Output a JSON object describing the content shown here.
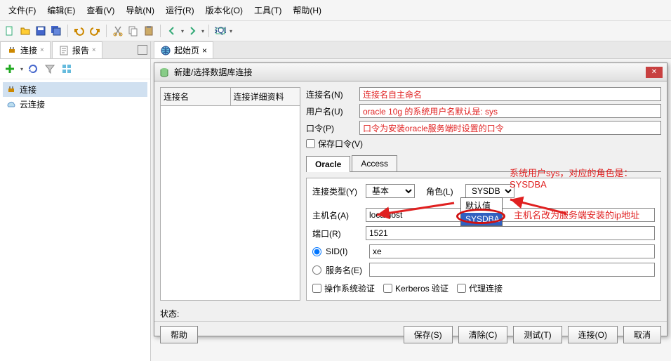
{
  "menu": [
    "文件(F)",
    "编辑(E)",
    "查看(V)",
    "导航(N)",
    "运行(R)",
    "版本化(O)",
    "工具(T)",
    "帮助(H)"
  ],
  "side_tabs": {
    "connections": "连接",
    "reports": "报告"
  },
  "tree": {
    "connections": "连接",
    "cloud": "云连接"
  },
  "content_tab": "起始页",
  "dialog": {
    "title": "新建/选择数据库连接",
    "left_cols": {
      "name": "连接名",
      "details": "连接详细资料"
    },
    "labels": {
      "conn_name": "连接名(N)",
      "username": "用户名(U)",
      "password": "口令(P)",
      "save_password": "保存口令(V)",
      "conn_type": "连接类型(Y)",
      "role": "角色(L)",
      "hostname": "主机名(A)",
      "port": "端口(R)",
      "sid": "SID(I)",
      "service": "服务名(E)",
      "os_auth": "操作系统验证",
      "kerberos": "Kerberos 验证",
      "proxy": "代理连接",
      "status": "状态:"
    },
    "tabs": {
      "oracle": "Oracle",
      "access": "Access"
    },
    "values": {
      "conn_type": "基本",
      "role": "SYSDBA",
      "role_options": [
        "默认值",
        "SYSDBA"
      ],
      "hostname": "localhost",
      "port": "1521",
      "sid": "xe"
    },
    "annotations": {
      "conn_name": "连接名自主命名",
      "username": "oracle 10g 的系统用户名默认是: sys",
      "password": "口令为安装oracle服务端时设置的口令",
      "role": "系统用户sys，对应的角色是：SYSDBA",
      "hostname": "主机名改为服务端安装的ip地址"
    },
    "buttons": {
      "help": "帮助",
      "save": "保存(S)",
      "clear": "清除(C)",
      "test": "测试(T)",
      "connect": "连接(O)",
      "cancel": "取消"
    }
  }
}
